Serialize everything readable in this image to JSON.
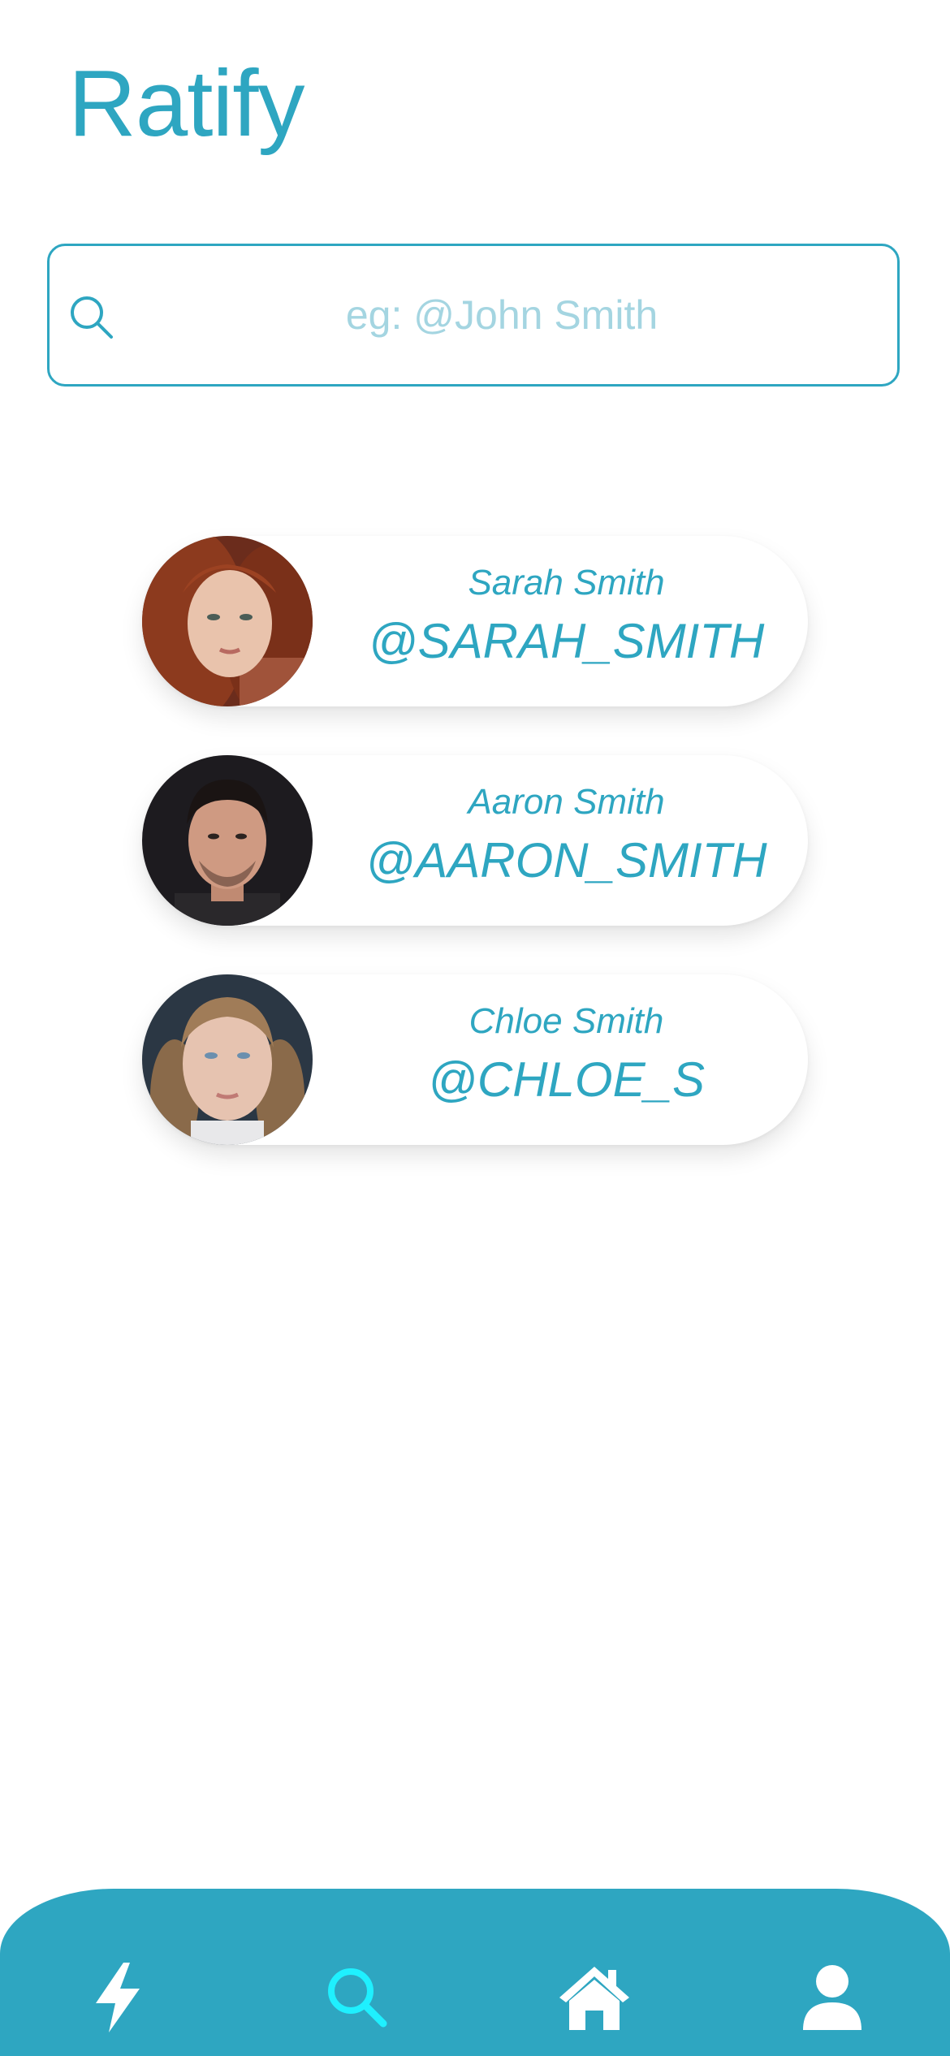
{
  "app": {
    "title": "Ratify"
  },
  "search": {
    "placeholder": "eg: @John Smith",
    "value": ""
  },
  "users": [
    {
      "name": "Sarah Smith",
      "handle": "@SARAH_SMITH"
    },
    {
      "name": "Aaron Smith",
      "handle": "@AARON_SMITH"
    },
    {
      "name": "Chloe Smith",
      "handle": "@CHLOE_S"
    }
  ],
  "nav": {
    "items": [
      {
        "icon": "lightning-icon",
        "active": false
      },
      {
        "icon": "search-icon",
        "active": true
      },
      {
        "icon": "home-icon",
        "active": false
      },
      {
        "icon": "profile-icon",
        "active": false
      }
    ]
  },
  "colors": {
    "accent": "#2ea6c1",
    "nav_background": "#2ea6c1",
    "nav_active_icon": "#1ff0ff",
    "nav_icon": "#ffffff",
    "placeholder": "#a4d5e1"
  }
}
